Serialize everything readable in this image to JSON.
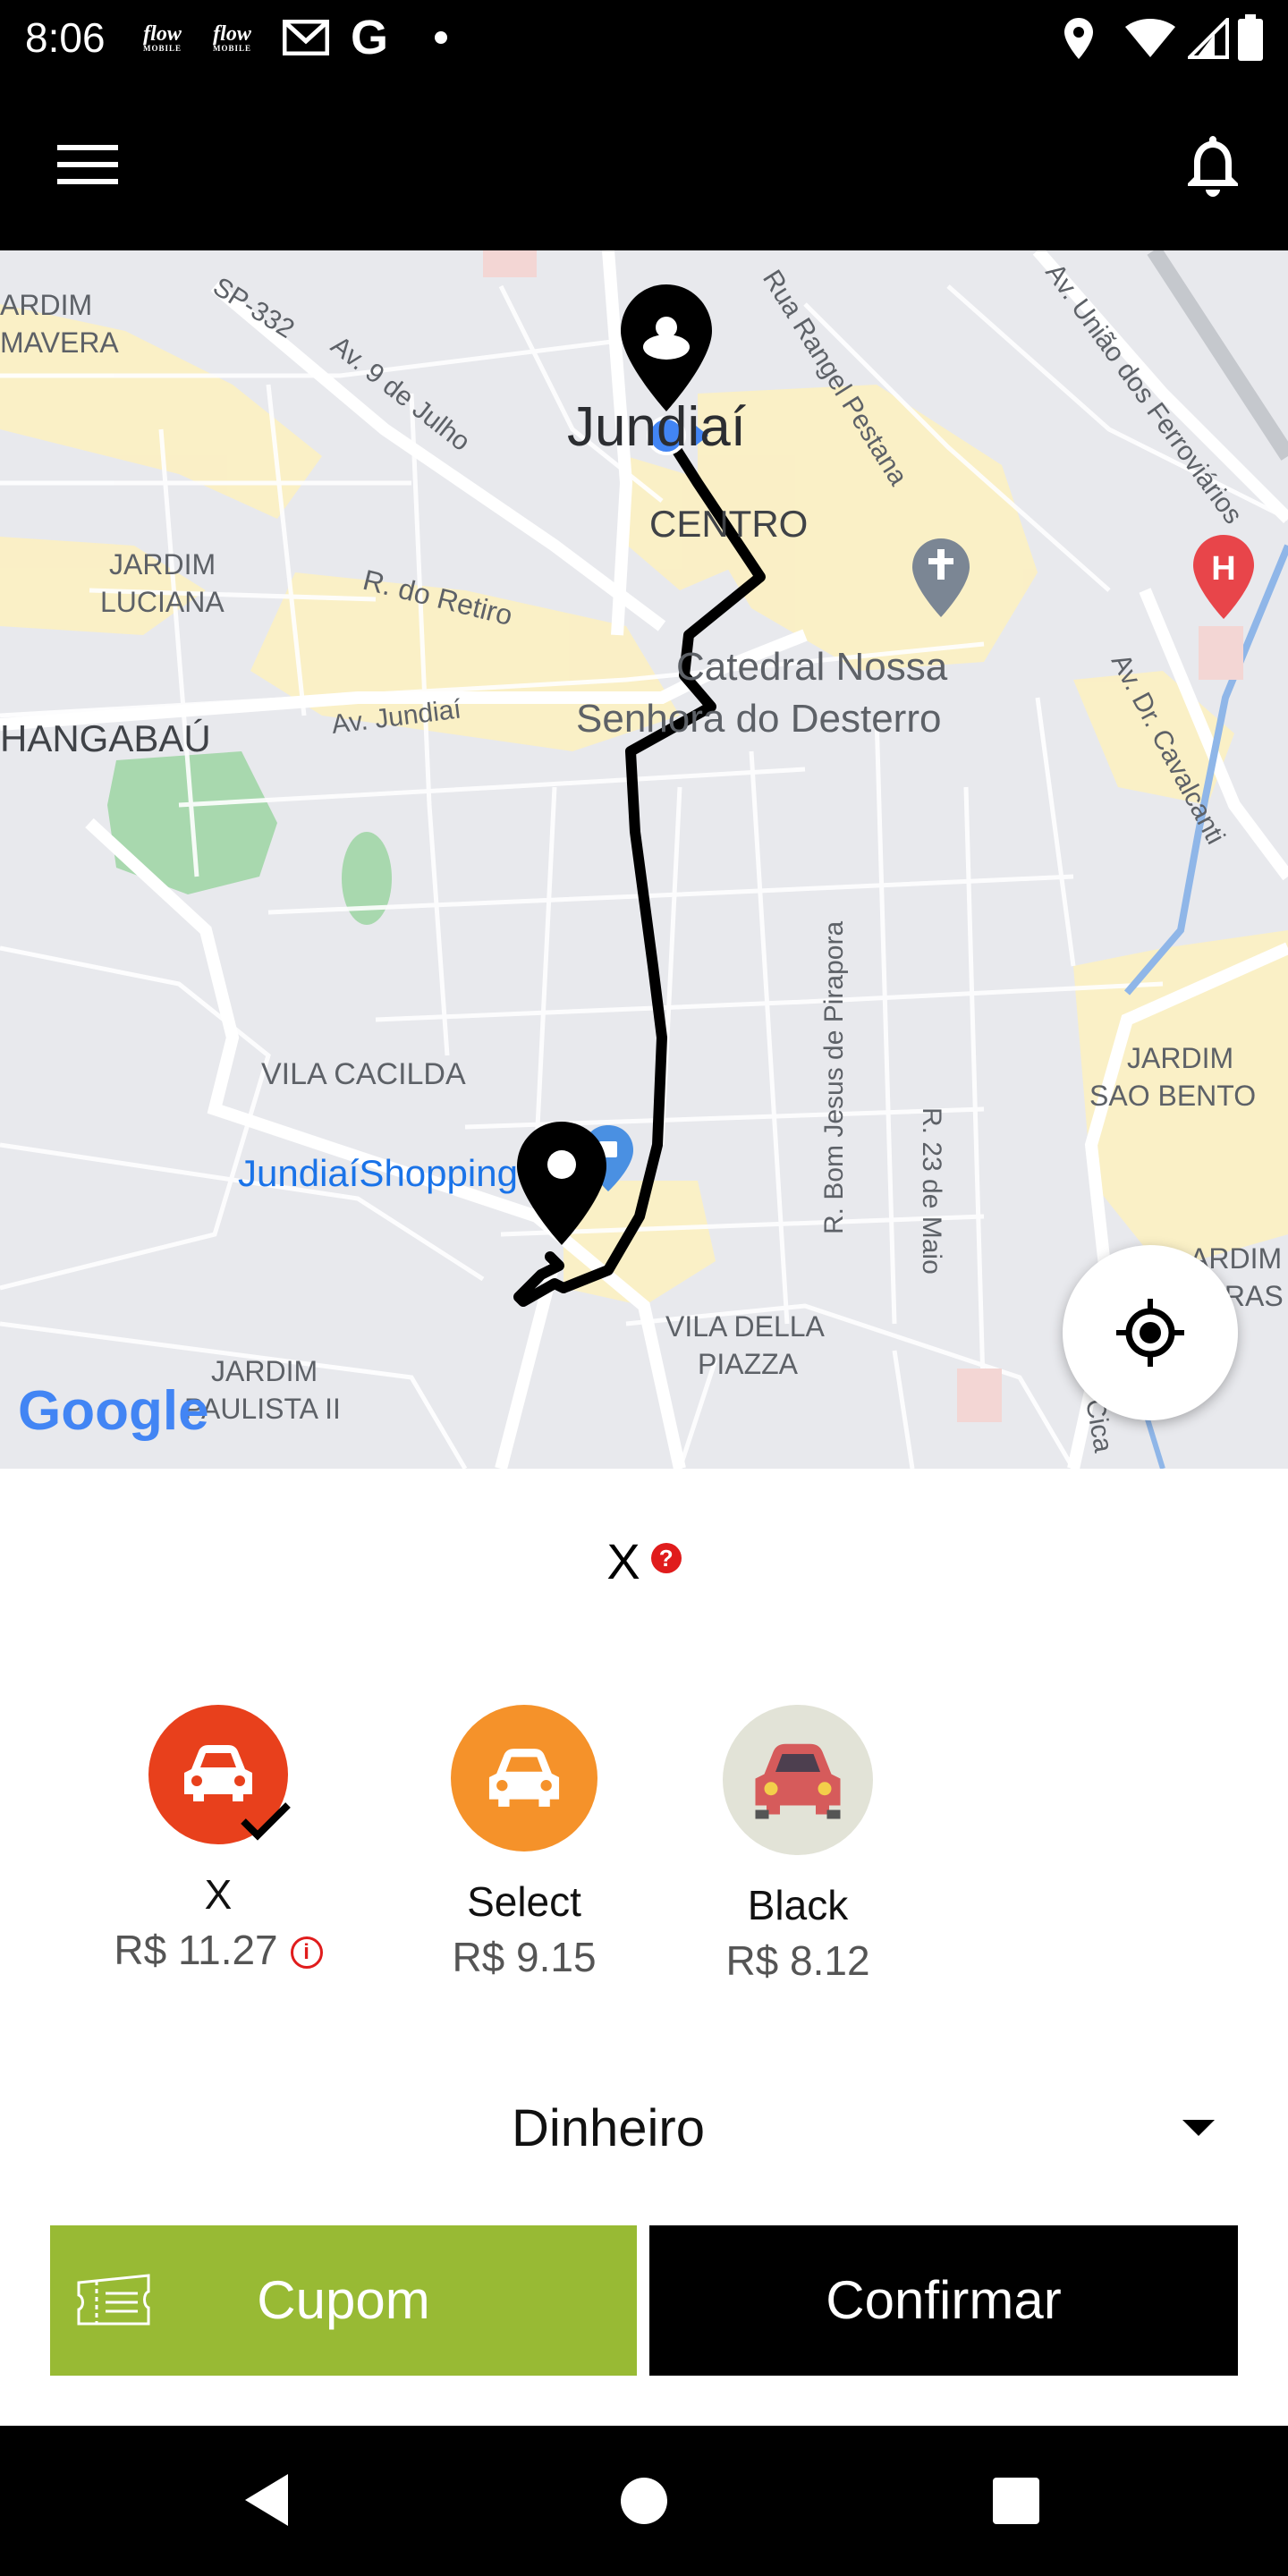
{
  "status_bar": {
    "time": "8:06",
    "notification_icons": [
      "flow-app-icon",
      "flow-app-icon",
      "gmail-icon",
      "google-icon",
      "dot-icon"
    ],
    "flow_label": "flow",
    "flow_sub": "MOBILE",
    "google_letter": "G",
    "system_icons": [
      "location-icon",
      "wifi-icon",
      "signal-icon",
      "battery-icon"
    ]
  },
  "app_bar": {
    "menu_icon": "hamburger-menu-icon",
    "notifications_icon": "bell-icon"
  },
  "map": {
    "labels": {
      "sp332": "SP-332",
      "jardim_mavera_1": "ARDIM",
      "jardim_mavera_2": "MAVERA",
      "av9julho": "Av. 9 de Julho",
      "rua_rangel": "Rua Rangel Pestana",
      "av_uniao": "Av. União dos Ferroviários",
      "jundiai": "Jundiaí",
      "centro": "CENTRO",
      "jardim_luciana_1": "JARDIM",
      "jardim_luciana_2": "LUCIANA",
      "r_retiro": "R. do Retiro",
      "catedral_1": "Catedral Nossa",
      "catedral_2": "Senhora do Desterro",
      "av_dr_cavalcanti": "Av. Dr. Cavalcanti",
      "anhangabau": "HANGABAÚ",
      "av_jundiai": "Av. Jundiaí",
      "r_bom_jesus": "R. Bom Jesus de Pirapora",
      "vila_cacilda": "VILA CACILDA",
      "jardim_sao_bento_1": "JARDIM",
      "jardim_sao_bento_2": "SAO BENTO",
      "jundiai_shopping": "JundiaíShopping",
      "r_23_maio": "R. 23 de Maio",
      "jardim_frag_1": "ARDIM",
      "jardim_frag_2": "IRAS",
      "vila_della_piazza_1": "VILA DELLA",
      "vila_della_piazza_2": "PIAZZA",
      "jardim_paulista_1": "JARDIM",
      "jardim_paulista_2": "PAULISTA II",
      "cica": "Cica",
      "google_logo": "Google"
    },
    "locate_icon": "my-location-icon"
  },
  "selection": {
    "title": "X",
    "help_glyph": "?",
    "options": [
      {
        "name": "X",
        "price": "R$ 11.27",
        "selected": true,
        "color": "#e8401c",
        "info_glyph": "i"
      },
      {
        "name": "Select",
        "price": "R$ 9.15",
        "selected": false,
        "color": "#f5922a"
      },
      {
        "name": "Black",
        "price": "R$ 8.12",
        "selected": false,
        "color": "#e2e3d7"
      }
    ]
  },
  "payment": {
    "method": "Dinheiro"
  },
  "actions": {
    "coupon_label": "Cupom",
    "confirm_label": "Confirmar"
  },
  "colors": {
    "coupon": "#98ba34",
    "confirm": "#000000",
    "selected_car": "#e8401c",
    "select_car": "#f5922a",
    "black_car_bg": "#e2e3d7",
    "black_car": "#d65b5b"
  }
}
